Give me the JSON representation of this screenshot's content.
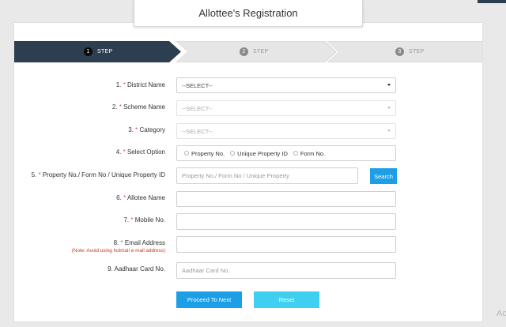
{
  "header": {
    "title": "Allottee's Registration"
  },
  "stepper": {
    "steps": [
      {
        "number": "1",
        "label": "STEP"
      },
      {
        "number": "2",
        "label": "STEP"
      },
      {
        "number": "3",
        "label": "STEP"
      }
    ]
  },
  "form": {
    "district": {
      "number": "1.",
      "req": "*",
      "label": "District Name",
      "value": "--SELECT--"
    },
    "scheme": {
      "number": "2.",
      "req": "*",
      "label": "Scheme Name",
      "value": "--SELECT--"
    },
    "category": {
      "number": "3.",
      "req": "*",
      "label": "Category",
      "value": "--SELECT--"
    },
    "select_option": {
      "number": "4.",
      "req": "*",
      "label": "Select Option",
      "options": [
        "Property No.",
        "Unique Property ID",
        "Form No."
      ]
    },
    "property": {
      "number": "5.",
      "req": "*",
      "label": "Property No./ Form No / Unique Property ID",
      "placeholder": "Property No./ Form No / Unique Property",
      "search_label": "Search"
    },
    "allotee_name": {
      "number": "6.",
      "req": "*",
      "label": "Allotee Name"
    },
    "mobile": {
      "number": "7.",
      "req": "*",
      "label": "Mobile No."
    },
    "email": {
      "number": "8.",
      "req": "*",
      "label": "Email Address",
      "note": "(Note: Avoid using hotmail e-mail address)"
    },
    "aadhaar": {
      "number": "9.",
      "label": "Aadhaar Card No.",
      "placeholder": "Aadhaar Card No."
    },
    "proceed_label": "Proceed To Next",
    "reset_label": "Reset"
  },
  "watermark": "Ac"
}
